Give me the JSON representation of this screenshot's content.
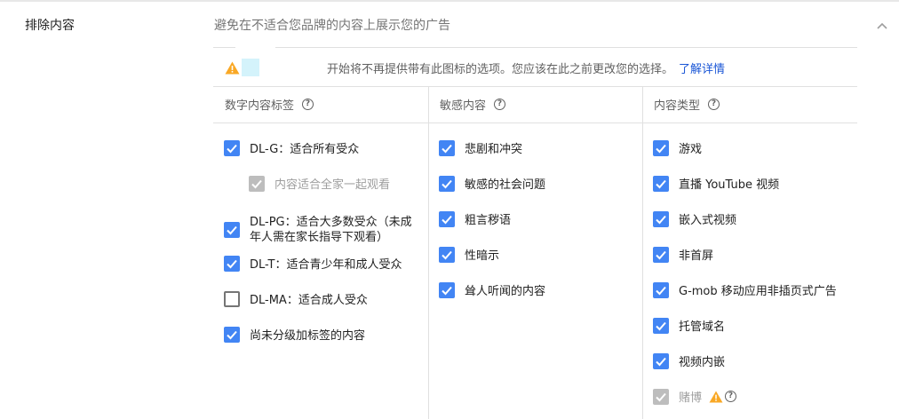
{
  "section": {
    "label": "排除内容",
    "description": "避免在不适合您品牌的内容上展示您的广告"
  },
  "warning": {
    "text": "开始将不再提供带有此图标的选项。您应该在此之前更改您的选择。",
    "link": "了解详情"
  },
  "columns": [
    {
      "header": "数字内容标签",
      "items": [
        {
          "label": "DL-G：适合所有受众",
          "checked": true
        },
        {
          "label": "内容适合全家一起观看",
          "checked": true,
          "disabled": true
        },
        {
          "label": "DL-PG：适合大多数受众（未成年人需在家长指导下观看）",
          "checked": true
        },
        {
          "label": "DL-T：适合青少年和成人受众",
          "checked": true
        },
        {
          "label": "DL-MA：适合成人受众",
          "checked": false
        },
        {
          "label": "尚未分级加标签的内容",
          "checked": true
        }
      ]
    },
    {
      "header": "敏感内容",
      "items": [
        {
          "label": "悲剧和冲突",
          "checked": true
        },
        {
          "label": "敏感的社会问题",
          "checked": true
        },
        {
          "label": "粗言秽语",
          "checked": true
        },
        {
          "label": "性暗示",
          "checked": true
        },
        {
          "label": "耸人听闻的内容",
          "checked": true
        }
      ]
    },
    {
      "header": "内容类型",
      "items": [
        {
          "label": "游戏",
          "checked": true
        },
        {
          "label": "直播 YouTube 视频",
          "checked": true
        },
        {
          "label": "嵌入式视频",
          "checked": true
        },
        {
          "label": "非首屏",
          "checked": true
        },
        {
          "label": "G-mob 移动应用非插页式广告",
          "checked": true
        },
        {
          "label": "托管域名",
          "checked": true
        },
        {
          "label": "视频内嵌",
          "checked": true
        },
        {
          "label": "赌博",
          "checked": true,
          "disabled": true
        }
      ]
    }
  ],
  "colors": {
    "accent": "#4285f4",
    "link": "#1a56d6",
    "warning": "#f9a825"
  }
}
